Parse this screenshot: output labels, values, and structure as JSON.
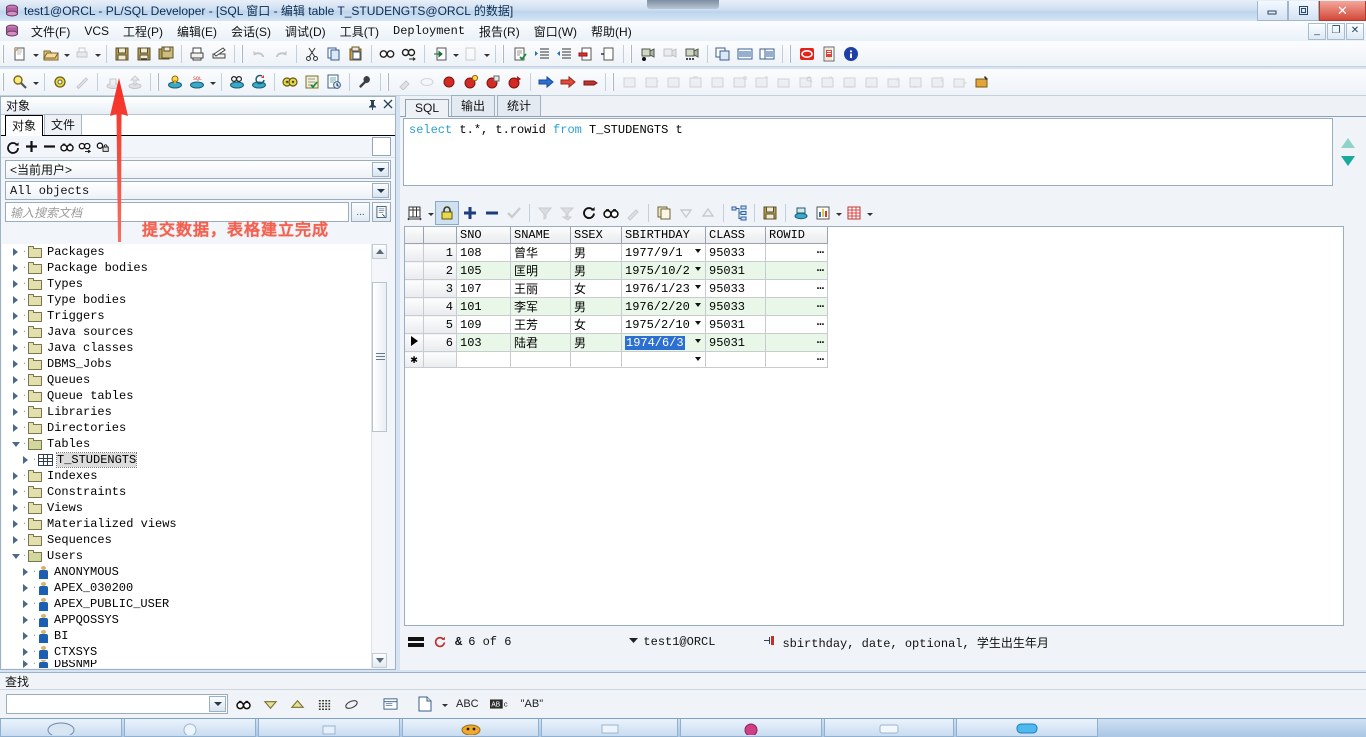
{
  "window": {
    "title": "test1@ORCL - PL/SQL Developer - [SQL 窗口 - 编辑 table T_STUDENGTS@ORCL 的数据]",
    "minimize": "–",
    "maximize": "❐",
    "close": "✕",
    "mdi_minimize": "_",
    "mdi_restore": "❐",
    "mdi_close": "✕"
  },
  "menu": {
    "items": [
      "文件(F)",
      "VCS",
      "工程(P)",
      "编辑(E)",
      "会话(S)",
      "调试(D)",
      "工具(T)",
      "Deployment",
      "报告(R)",
      "窗口(W)",
      "帮助(H)"
    ]
  },
  "object_browser": {
    "dock_title": "对象",
    "pin_icon": "pin-icon",
    "close_icon": "close-icon",
    "tabs": [
      {
        "label": "对象",
        "active": true
      },
      {
        "label": "文件",
        "active": false
      }
    ],
    "toolbar_icons": [
      "refresh-icon",
      "plus-icon",
      "minus-icon",
      "binoculars-icon",
      "find-next-icon",
      "find-lock-icon"
    ],
    "user_filter": "<当前用户>",
    "type_filter": "All objects",
    "search_placeholder": "输入搜索文档",
    "search_value": "",
    "browse_button": "...",
    "export_button": "export-icon",
    "tree": [
      {
        "label": "Packages",
        "kind": "folder",
        "indent": 0,
        "state": "collapsed"
      },
      {
        "label": "Package bodies",
        "kind": "folder",
        "indent": 0,
        "state": "collapsed"
      },
      {
        "label": "Types",
        "kind": "folder",
        "indent": 0,
        "state": "collapsed"
      },
      {
        "label": "Type bodies",
        "kind": "folder",
        "indent": 0,
        "state": "collapsed"
      },
      {
        "label": "Triggers",
        "kind": "folder",
        "indent": 0,
        "state": "collapsed"
      },
      {
        "label": "Java sources",
        "kind": "folder",
        "indent": 0,
        "state": "collapsed"
      },
      {
        "label": "Java classes",
        "kind": "folder",
        "indent": 0,
        "state": "collapsed"
      },
      {
        "label": "DBMS_Jobs",
        "kind": "folder",
        "indent": 0,
        "state": "collapsed"
      },
      {
        "label": "Queues",
        "kind": "folder",
        "indent": 0,
        "state": "collapsed"
      },
      {
        "label": "Queue tables",
        "kind": "folder",
        "indent": 0,
        "state": "collapsed"
      },
      {
        "label": "Libraries",
        "kind": "folder",
        "indent": 0,
        "state": "collapsed"
      },
      {
        "label": "Directories",
        "kind": "folder",
        "indent": 0,
        "state": "collapsed"
      },
      {
        "label": "Tables",
        "kind": "folder-open",
        "indent": 0,
        "state": "expanded"
      },
      {
        "label": "T_STUDENGTS",
        "kind": "table",
        "indent": 1,
        "state": "collapsed",
        "selected": true
      },
      {
        "label": "Indexes",
        "kind": "folder",
        "indent": 0,
        "state": "collapsed"
      },
      {
        "label": "Constraints",
        "kind": "folder",
        "indent": 0,
        "state": "collapsed"
      },
      {
        "label": "Views",
        "kind": "folder",
        "indent": 0,
        "state": "collapsed"
      },
      {
        "label": "Materialized views",
        "kind": "folder",
        "indent": 0,
        "state": "collapsed"
      },
      {
        "label": "Sequences",
        "kind": "folder",
        "indent": 0,
        "state": "collapsed"
      },
      {
        "label": "Users",
        "kind": "folder-open",
        "indent": 0,
        "state": "expanded"
      },
      {
        "label": "ANONYMOUS",
        "kind": "user",
        "indent": 1,
        "state": "collapsed"
      },
      {
        "label": "APEX_030200",
        "kind": "user",
        "indent": 1,
        "state": "collapsed"
      },
      {
        "label": "APEX_PUBLIC_USER",
        "kind": "user",
        "indent": 1,
        "state": "collapsed"
      },
      {
        "label": "APPQOSSYS",
        "kind": "user",
        "indent": 1,
        "state": "collapsed"
      },
      {
        "label": "BI",
        "kind": "user",
        "indent": 1,
        "state": "collapsed"
      },
      {
        "label": "CTXSYS",
        "kind": "user",
        "indent": 1,
        "state": "collapsed"
      },
      {
        "label": "DBSNMP",
        "kind": "user",
        "indent": 1,
        "state": "collapsed"
      }
    ]
  },
  "sql_window": {
    "tabs": [
      {
        "label": "SQL",
        "active": true
      },
      {
        "label": "输出",
        "active": false
      },
      {
        "label": "统计",
        "active": false
      }
    ],
    "statement_parts": [
      {
        "text": "select",
        "kw": true
      },
      {
        "text": " t.*, t.rowid ",
        "kw": false
      },
      {
        "text": "from",
        "kw": true
      },
      {
        "text": " T_STUDENGTS t",
        "kw": false
      }
    ],
    "statement_plain": "select t.*, t.rowid from T_STUDENGTS t"
  },
  "grid": {
    "columns": [
      "SNO",
      "SNAME",
      "SSEX",
      "SBIRTHDAY",
      "CLASS",
      "ROWID"
    ],
    "rows": [
      {
        "n": "1",
        "SNO": "108",
        "SNAME": "曾华",
        "SSEX": "男",
        "SBIRTHDAY": "1977/9/1",
        "CLASS": "95033",
        "ROWID": "⋯",
        "current": false,
        "selected_cell": false
      },
      {
        "n": "2",
        "SNO": "105",
        "SNAME": "匡明",
        "SSEX": "男",
        "SBIRTHDAY": "1975/10/2",
        "CLASS": "95031",
        "ROWID": "⋯",
        "current": false,
        "selected_cell": false
      },
      {
        "n": "3",
        "SNO": "107",
        "SNAME": "王丽",
        "SSEX": "女",
        "SBIRTHDAY": "1976/1/23",
        "CLASS": "95033",
        "ROWID": "⋯",
        "current": false,
        "selected_cell": false
      },
      {
        "n": "4",
        "SNO": "101",
        "SNAME": "李军",
        "SSEX": "男",
        "SBIRTHDAY": "1976/2/20",
        "CLASS": "95033",
        "ROWID": "⋯",
        "current": false,
        "selected_cell": false
      },
      {
        "n": "5",
        "SNO": "109",
        "SNAME": "王芳",
        "SSEX": "女",
        "SBIRTHDAY": "1975/2/10",
        "CLASS": "95031",
        "ROWID": "⋯",
        "current": false,
        "selected_cell": false
      },
      {
        "n": "6",
        "SNO": "103",
        "SNAME": "陆君",
        "SSEX": "男",
        "SBIRTHDAY": "1974/6/3",
        "CLASS": "95031",
        "ROWID": "⋯",
        "current": true,
        "selected_cell": true
      }
    ],
    "new_row_marker": "✱"
  },
  "data_status": {
    "record_position": "6 of 6",
    "connection": "test1@ORCL",
    "column_hint": "sbirthday, date, optional, 学生出生年月"
  },
  "find_bar": {
    "title": "查找",
    "value": "",
    "buttons": [
      "binoculars-icon",
      "down-triangle-icon",
      "up-triangle-icon",
      "list-icon",
      "eraser-icon",
      "panel-icon",
      "page-icon"
    ],
    "label_abc": "ABC",
    "label_ab_boxed": "AB",
    "label_ab_quoted": "\"AB\""
  },
  "annotation": {
    "text": "提交数据，表格建立完成",
    "color": "#f4604f",
    "arrow_target": "commit-button"
  },
  "toolbar_row1": [
    "new-icon",
    "open-icon",
    "print-preview-icon",
    "save-icon",
    "save-all-icon",
    "save-session-icon",
    "print-icon",
    "print-setup-icon",
    "undo-icon",
    "redo-icon",
    "cut-icon",
    "copy-icon",
    "paste-icon",
    "find-icon",
    "find-next-icon",
    "import-icon",
    "export-disabled-icon",
    "explain-icon",
    "indent-icon",
    "outdent-icon",
    "comment-icon",
    "uncomment-icon",
    "record-icon",
    "step-icon",
    "macro-icon",
    "tile-icon",
    "list-window-icon",
    "detail-window-icon",
    "stop-icon",
    "pdf-icon",
    "info-icon"
  ],
  "toolbar_row2": [
    "zoom-icon",
    "settings-icon",
    "wand-icon",
    "rollback-icon",
    "commit-icon",
    "execute-icon",
    "execute-sql-icon",
    "explain-plan-icon",
    "session-icon",
    "test-icon",
    "checklist-icon",
    "report-icon",
    "wrench-icon",
    "brush-icon",
    "eraser2-icon",
    "bp1-icon",
    "bp2-icon",
    "bp3-icon",
    "bp4-icon",
    "run-icon",
    "step-over-icon",
    "stop2-icon",
    "obj1-icon",
    "obj2-icon",
    "obj3-icon",
    "obj4-icon",
    "obj5-icon",
    "obj6-icon",
    "obj7-icon",
    "obj8-icon",
    "obj9-icon",
    "obj10-icon",
    "obj11-icon",
    "obj12-icon",
    "obj13-icon",
    "obj14-icon",
    "obj15-icon",
    "obj16-icon",
    "obj17-icon"
  ],
  "grid_toolbar": [
    "grid-layout-icon",
    "lock-icon",
    "insert-row-icon",
    "delete-row-icon",
    "post-icon",
    "filter-down-icon",
    "filter-all-icon",
    "refresh-icon",
    "search-icon",
    "edit-icon",
    "copy-grid-icon",
    "sort-desc-icon",
    "sort-asc-icon",
    "hierarchy-icon",
    "save-grid-icon",
    "db-icon",
    "chart-icon",
    "table-view-icon"
  ],
  "colors": {
    "annotation": "#f4604f",
    "alt_row": "#e9f7e9",
    "selection": "#2b6fd1",
    "keyword": "#2a9fd6",
    "titlebar_close": "#d3493a"
  },
  "taskbar": {
    "items": [
      "task-1",
      "task-2",
      "task-3",
      "task-4",
      "task-5",
      "task-6",
      "task-7",
      "task-8"
    ]
  }
}
